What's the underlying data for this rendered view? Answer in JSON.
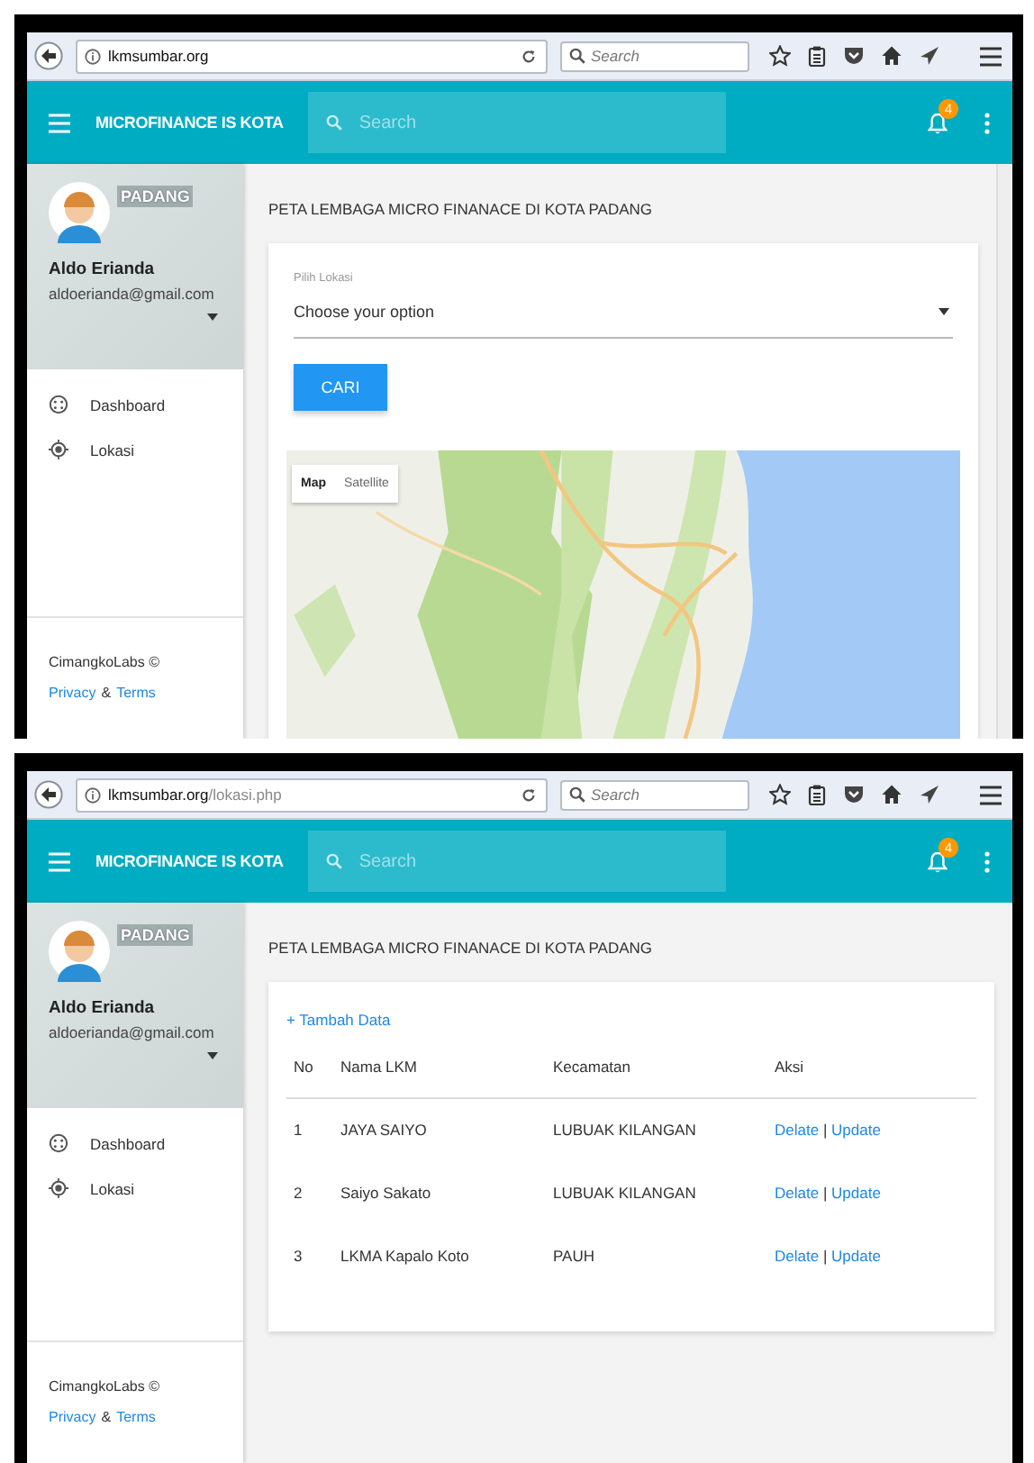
{
  "screens": [
    {
      "browser": {
        "host": "lkmsumbar.org",
        "search_placeholder": "Search"
      },
      "app": {
        "title": "MICROFINANCE IS KOTA",
        "search_placeholder": "Search",
        "notification_count": "4"
      },
      "profile": {
        "city": "PADANG",
        "name": "Aldo Erianda",
        "email": "aldoerianda@gmail.com"
      },
      "nav": [
        {
          "label": "Dashboard",
          "kind": "dashboard"
        },
        {
          "label": "Lokasi",
          "kind": "location"
        }
      ],
      "footer": {
        "company": "CimangkoLabs ©",
        "privacy": "Privacy",
        "amp": "&",
        "terms": "Terms"
      },
      "page_title": "PETA LEMBAGA MICRO FINANACE DI KOTA PADANG",
      "content": {
        "kind": "map",
        "field_label": "Pilih Lokasi",
        "select_value": "Choose your option",
        "button": "CARI",
        "map_modes": [
          {
            "label": "Map",
            "selected": true
          },
          {
            "label": "Satellite",
            "selected": false
          }
        ]
      }
    },
    {
      "browser": {
        "host": "lkmsumbar.org",
        "path": "/lokasi.php",
        "search_placeholder": "Search"
      },
      "app": {
        "title": "MICROFINANCE IS KOTA",
        "search_placeholder": "Search",
        "notification_count": "4"
      },
      "profile": {
        "city": "PADANG",
        "name": "Aldo Erianda",
        "email": "aldoerianda@gmail.com"
      },
      "nav": [
        {
          "label": "Dashboard",
          "kind": "dashboard"
        },
        {
          "label": "Lokasi",
          "kind": "location"
        }
      ],
      "footer": {
        "company": "CimangkoLabs ©",
        "privacy": "Privacy",
        "amp": "&",
        "terms": "Terms"
      },
      "page_title": "PETA LEMBAGA MICRO FINANACE DI KOTA PADANG",
      "content": {
        "kind": "table",
        "add_link": "+ Tambah Data",
        "columns": [
          "No",
          "Nama LKM",
          "Kecamatan",
          "Aksi"
        ],
        "rows": [
          {
            "no": "1",
            "name": "JAYA SAIYO",
            "district": "LUBUAK KILANGAN",
            "delete": "Delate",
            "separator": "|",
            "update": "Update"
          },
          {
            "no": "2",
            "name": "Saiyo Sakato",
            "district": "LUBUAK KILANGAN",
            "delete": "Delate",
            "separator": "|",
            "update": "Update"
          },
          {
            "no": "3",
            "name": "LKMA Kapalo Koto",
            "district": "PAUH",
            "delete": "Delate",
            "separator": "|",
            "update": "Update"
          }
        ]
      }
    }
  ]
}
